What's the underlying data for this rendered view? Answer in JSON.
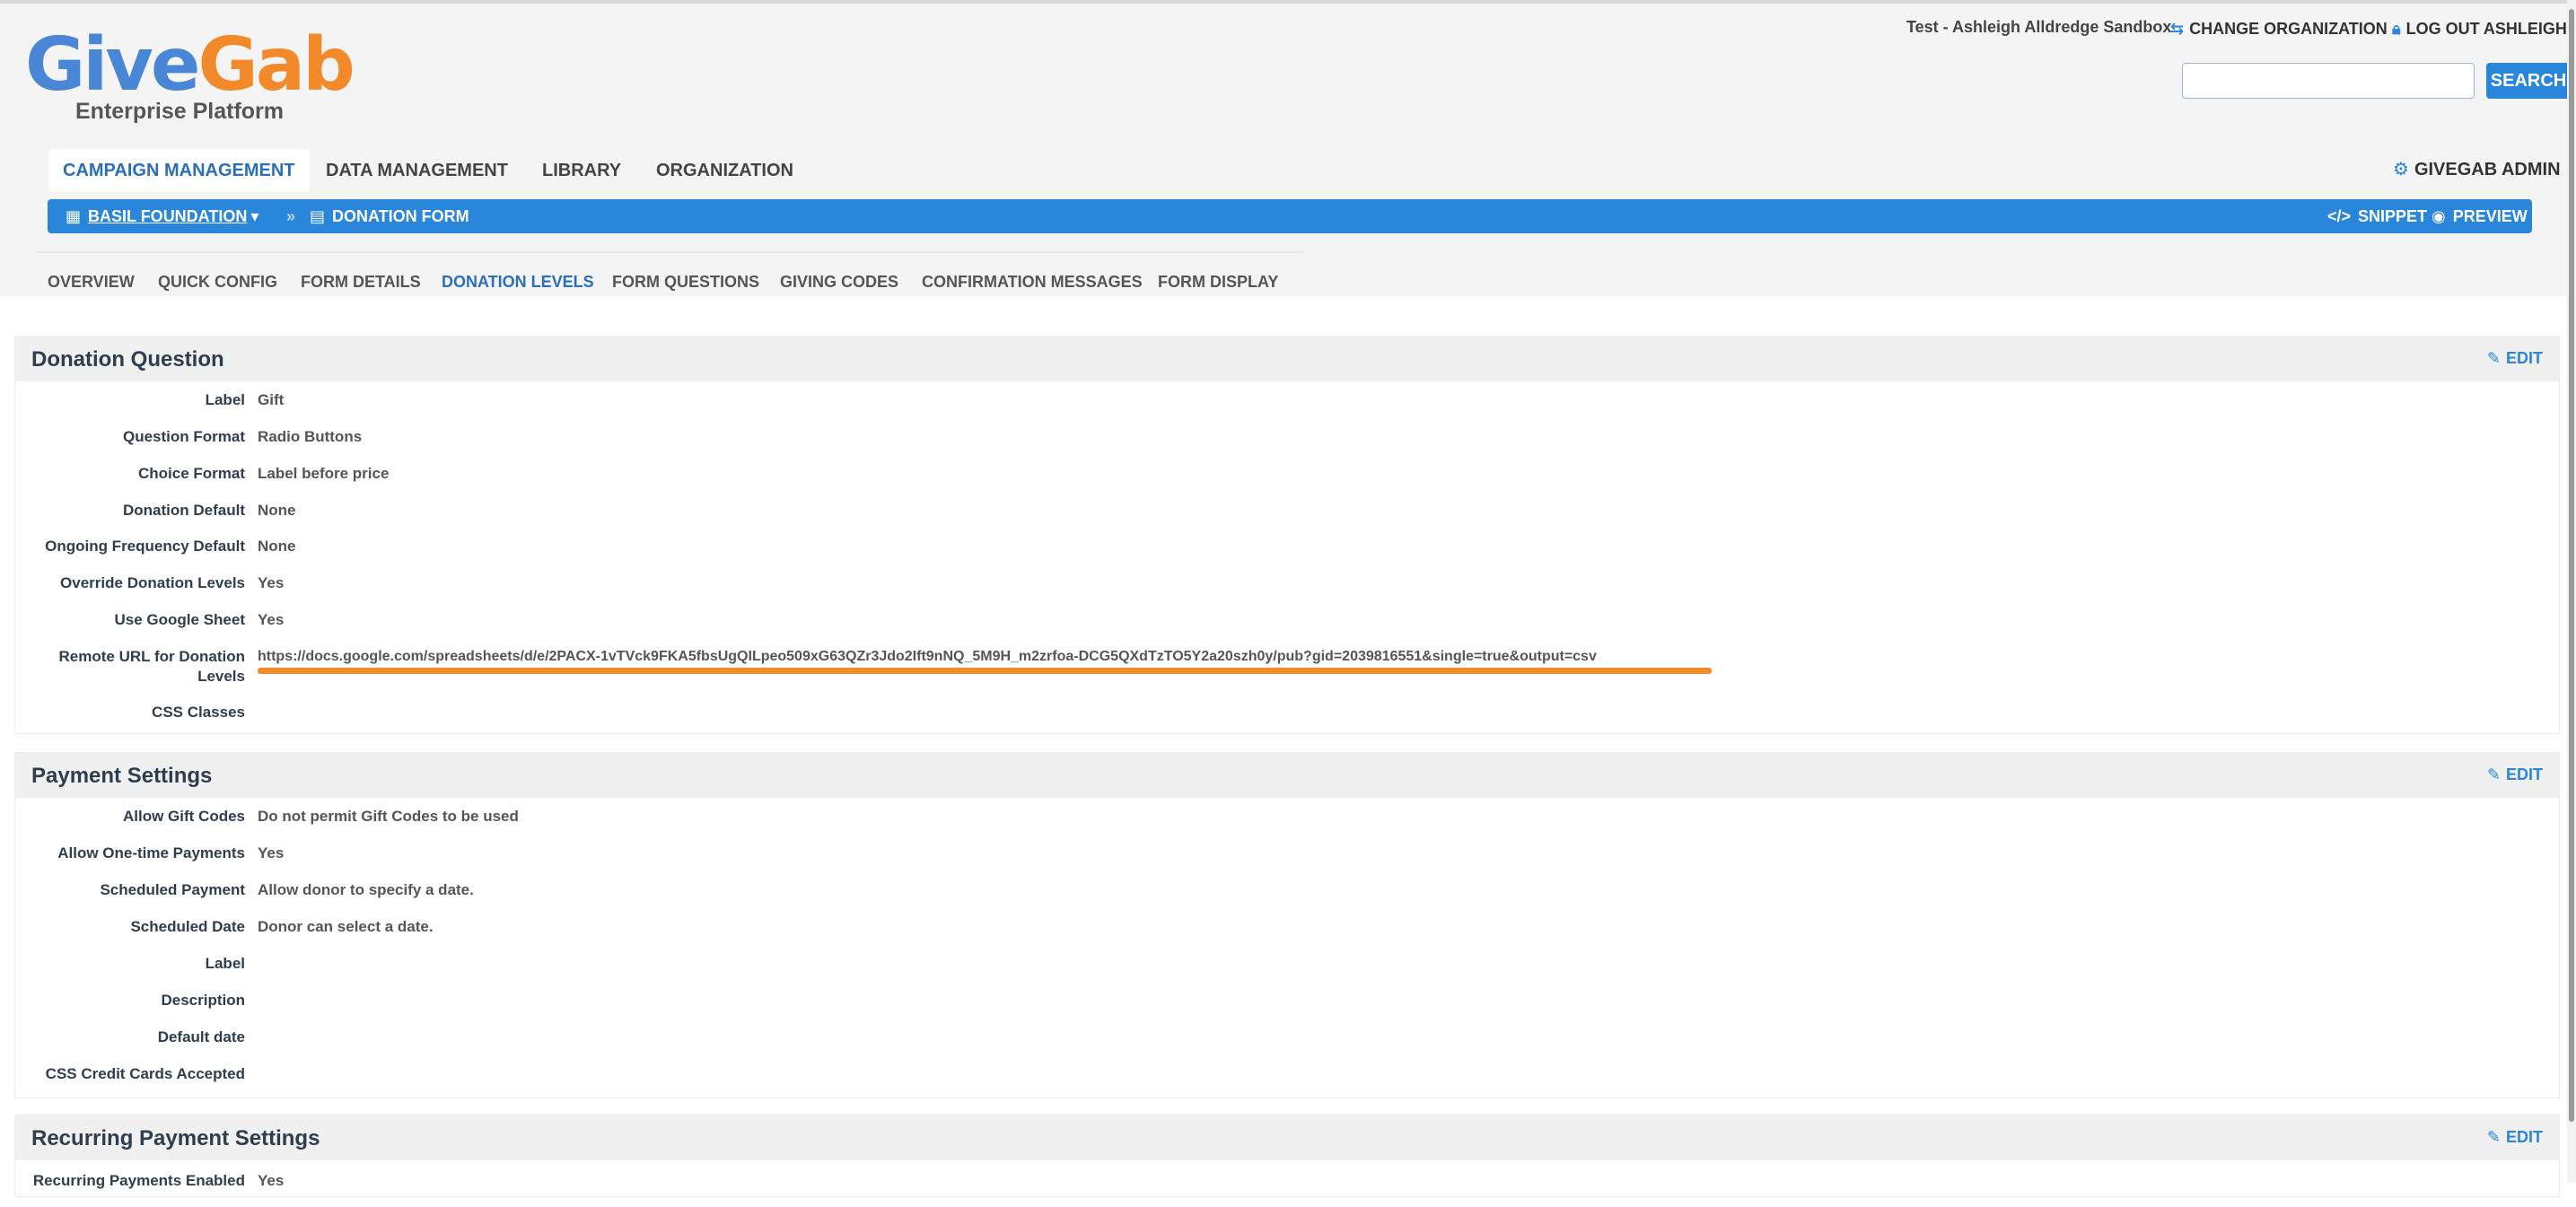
{
  "brand": {
    "name_part1": "Give",
    "name_part2": "Gab",
    "subtitle": "Enterprise Platform"
  },
  "top_util": {
    "org_name": "Test - Ashleigh Alldredge Sandbox",
    "change_org": "CHANGE ORGANIZATION",
    "logout": "LOG OUT ASHLEIGH"
  },
  "search": {
    "button": "SEARCH",
    "placeholder": ""
  },
  "main_nav": {
    "tabs": [
      {
        "label": "CAMPAIGN MANAGEMENT",
        "active": true
      },
      {
        "label": "DATA MANAGEMENT"
      },
      {
        "label": "LIBRARY"
      },
      {
        "label": "ORGANIZATION"
      }
    ],
    "admin": "GIVEGAB ADMIN"
  },
  "breadcrumb": {
    "org": "BASIL FOUNDATION",
    "page": "DONATION FORM",
    "snippet": "SNIPPET",
    "preview": "PREVIEW"
  },
  "sub_nav": [
    "OVERVIEW",
    "QUICK CONFIG",
    "FORM DETAILS",
    "DONATION LEVELS",
    "FORM QUESTIONS",
    "GIVING CODES",
    "CONFIRMATION MESSAGES",
    "FORM DISPLAY"
  ],
  "sub_nav_active": "DONATION LEVELS",
  "sections": {
    "donation": {
      "title": "Donation Question",
      "edit": "EDIT",
      "rows": [
        {
          "label": "Label",
          "value": "Gift"
        },
        {
          "label": "Question Format",
          "value": "Radio Buttons"
        },
        {
          "label": "Choice Format",
          "value": "Label before price"
        },
        {
          "label": "Donation Default",
          "value": "None"
        },
        {
          "label": "Ongoing Frequency Default",
          "value": "None"
        },
        {
          "label": "Override Donation Levels",
          "value": "Yes"
        },
        {
          "label": "Use Google Sheet",
          "value": "Yes"
        },
        {
          "label": "Remote URL for Donation Levels",
          "value": "https://docs.google.com/spreadsheets/d/e/2PACX-1vTVck9FKA5fbsUgQILpeo509xG63QZr3Jdo2Ift9nNQ_5M9H_m2zrfoa-DCG5QXdTzTO5Y2a20szh0y/pub?gid=2039816551&single=true&output=csv"
        },
        {
          "label": "CSS Classes",
          "value": ""
        }
      ]
    },
    "payment": {
      "title": "Payment Settings",
      "edit": "EDIT",
      "rows": [
        {
          "label": "Allow Gift Codes",
          "value": "Do not permit Gift Codes to be used"
        },
        {
          "label": "Allow One-time Payments",
          "value": "Yes"
        },
        {
          "label": "Scheduled Payment",
          "value": "Allow donor to specify a date."
        },
        {
          "label": "Scheduled Date",
          "value": "Donor can select a date."
        },
        {
          "label": "Label",
          "value": ""
        },
        {
          "label": "Description",
          "value": ""
        },
        {
          "label": "Default date",
          "value": ""
        },
        {
          "label": "CSS Credit Cards Accepted",
          "value": ""
        }
      ]
    },
    "recurring": {
      "title": "Recurring Payment Settings",
      "edit": "EDIT",
      "rows": [
        {
          "label": "Recurring Payments Enabled",
          "value": "Yes"
        }
      ]
    }
  },
  "colors": {
    "accent": "#2a86db",
    "brand_orange": "#f28a2c",
    "brand_blue": "#4a86d6"
  }
}
